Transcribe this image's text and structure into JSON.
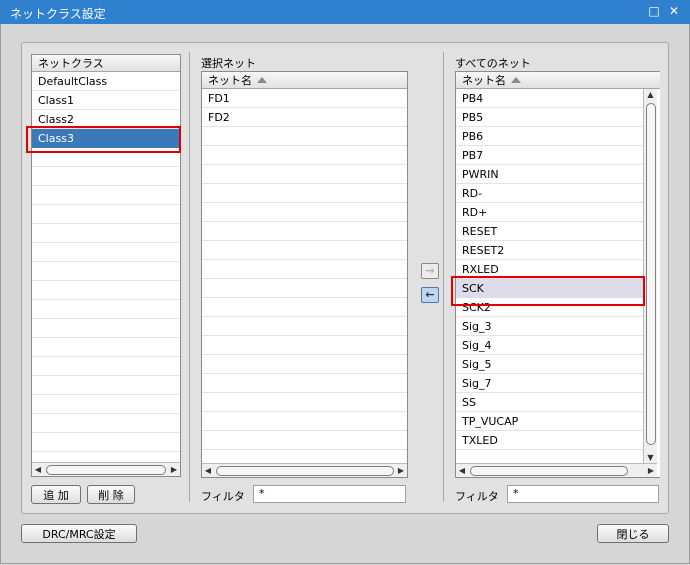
{
  "window": {
    "title": "ネットクラス設定"
  },
  "left": {
    "header": "ネットクラス",
    "items": [
      "DefaultClass",
      "Class1",
      "Class2",
      "Class3"
    ],
    "selected_index": 3,
    "add_label": "追 加",
    "delete_label": "削 除"
  },
  "middle": {
    "group_label": "選択ネット",
    "column_header": "ネット名",
    "items": [
      "FD1",
      "FD2"
    ],
    "filter_label": "フィルタ",
    "filter_value": "*"
  },
  "transfer": {
    "add_icon": "arrow-right-icon",
    "remove_icon": "arrow-left-icon"
  },
  "right": {
    "group_label": "すべてのネット",
    "column_header": "ネット名",
    "items": [
      "PB4",
      "PB5",
      "PB6",
      "PB7",
      "PWRIN",
      "RD-",
      "RD+",
      "RESET",
      "RESET2",
      "RXLED",
      "SCK",
      "SCK2",
      "Sig_3",
      "Sig_4",
      "Sig_5",
      "Sig_7",
      "SS",
      "TP_VUCAP",
      "TXLED"
    ],
    "hover_index": 10,
    "filter_label": "フィルタ",
    "filter_value": "*"
  },
  "footer": {
    "drc_label": "DRC/MRC設定",
    "close_label": "閉じる"
  },
  "colors": {
    "title_bar": "#2f80cf",
    "selection": "#3c79b9",
    "highlight_border": "#e00000"
  }
}
